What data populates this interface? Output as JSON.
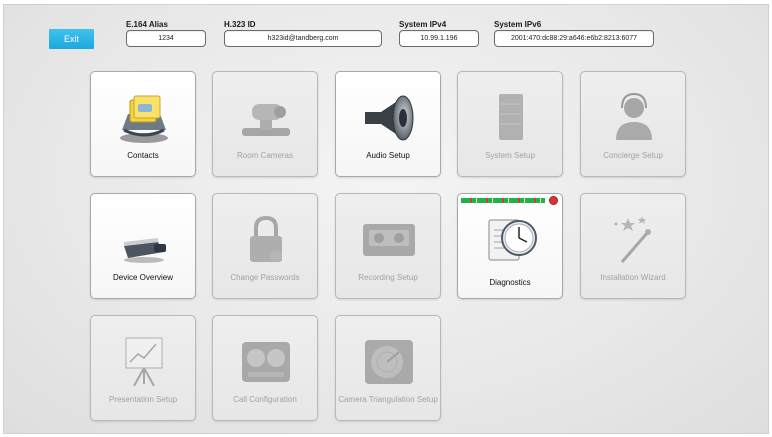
{
  "header": {
    "exit_label": "Exit",
    "fields": [
      {
        "label": "E.164 Alias",
        "value": "1234"
      },
      {
        "label": "H.323 ID",
        "value": "h323id@tandberg.com"
      },
      {
        "label": "System IPv4",
        "value": "10.99.1.196"
      },
      {
        "label": "System IPv6",
        "value": "2001:470:dc88:29:a646:e6b2:8213:6077"
      }
    ]
  },
  "tiles": [
    {
      "label": "Contacts",
      "icon": "contacts-rolodex-icon",
      "enabled": true
    },
    {
      "label": "Room Cameras",
      "icon": "camera-icon",
      "enabled": false
    },
    {
      "label": "Audio Setup",
      "icon": "speaker-icon",
      "enabled": true
    },
    {
      "label": "System Setup",
      "icon": "server-icon",
      "enabled": false
    },
    {
      "label": "Concierge Setup",
      "icon": "headset-person-icon",
      "enabled": false
    },
    {
      "label": "Device Overview",
      "icon": "codec-device-icon",
      "enabled": true
    },
    {
      "label": "Change Passwords",
      "icon": "padlock-icon",
      "enabled": false
    },
    {
      "label": "Recording Setup",
      "icon": "tape-recorder-icon",
      "enabled": false
    },
    {
      "label": "Diagnostics",
      "icon": "clock-clipboard-icon",
      "enabled": true
    },
    {
      "label": "Installation Wizard",
      "icon": "magic-wand-icon",
      "enabled": false
    },
    {
      "label": "Presentation Setup",
      "icon": "easel-chart-icon",
      "enabled": false
    },
    {
      "label": "Call Configuration",
      "icon": "gauges-icon",
      "enabled": false
    },
    {
      "label": "Camera Triangulation Setup",
      "icon": "radar-icon",
      "enabled": false
    }
  ],
  "colors": {
    "exit_button": "#1ea8dc",
    "diag_ok": "#21b24a",
    "diag_alert": "#d83434"
  }
}
